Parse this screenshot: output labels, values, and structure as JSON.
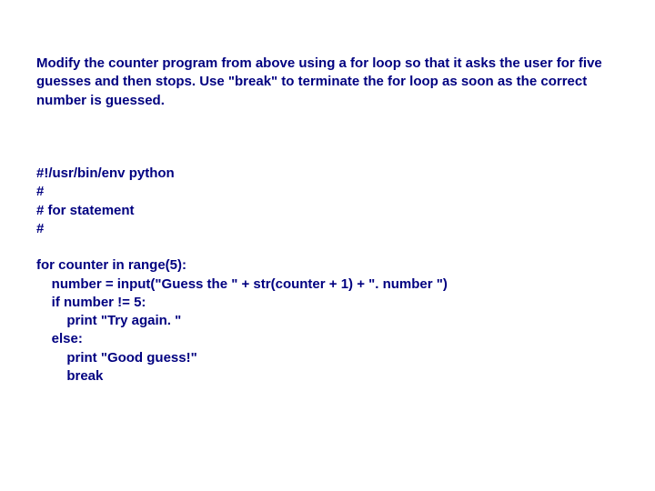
{
  "instruction": "Modify the counter program from above using a for loop so that it asks the user for five guesses and then stops. Use \"break\" to terminate the for loop as soon as the correct number is guessed.",
  "code": {
    "l1": "#!/usr/bin/env python",
    "l2": "#",
    "l3": "# for statement",
    "l4": "#",
    "l5": "",
    "l6": "for counter in range(5):",
    "l7": "    number = input(\"Guess the \" + str(counter + 1) + \". number \")",
    "l8": "    if number != 5:",
    "l9": "        print \"Try again. \"",
    "l10": "    else:",
    "l11": "        print \"Good guess!\"",
    "l12": "        break"
  }
}
